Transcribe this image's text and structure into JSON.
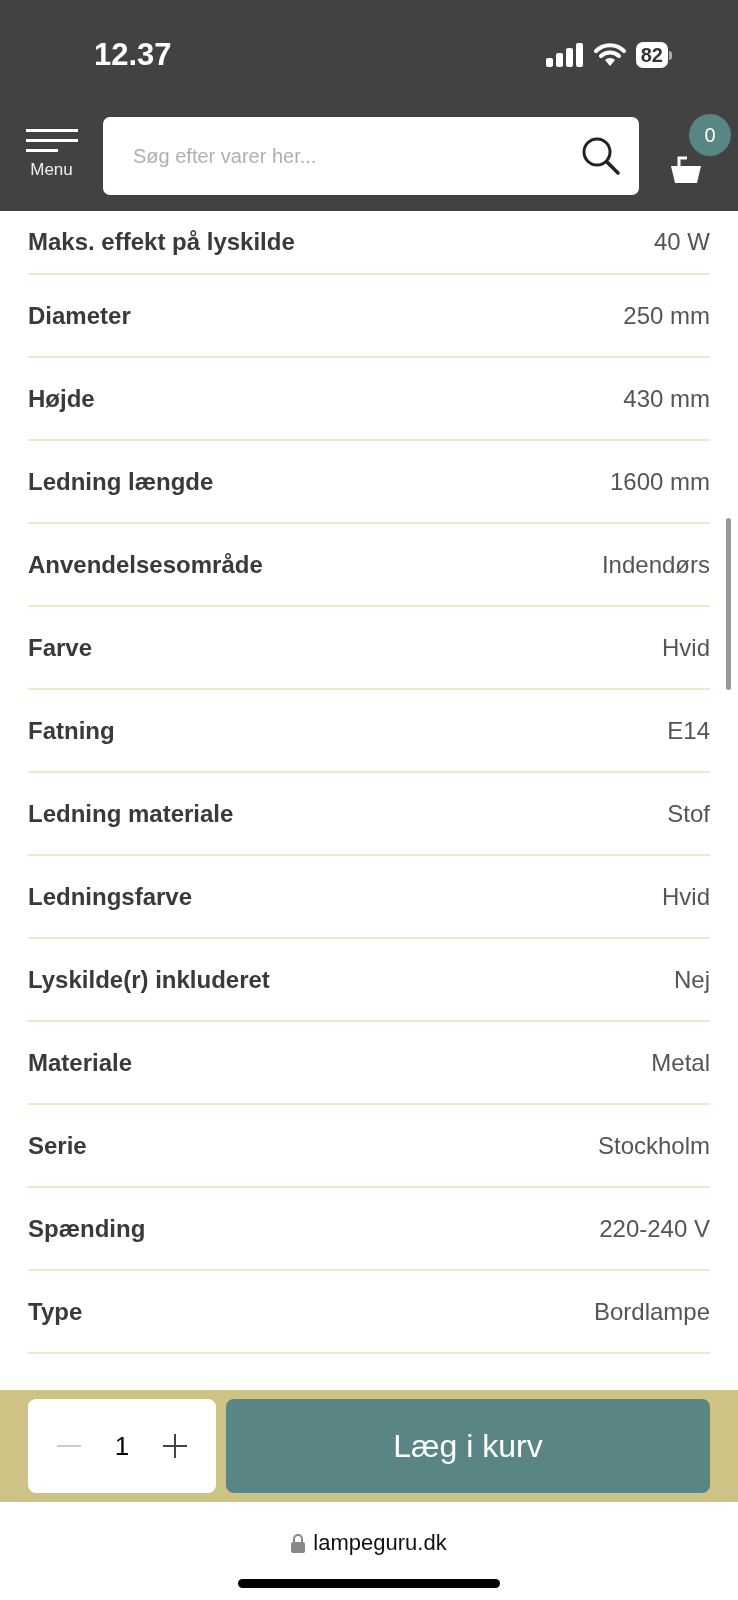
{
  "status_bar": {
    "time": "12.37",
    "battery": "82"
  },
  "header": {
    "menu_label": "Menu",
    "search": {
      "placeholder": "Søg efter varer her..."
    },
    "cart_count": "0"
  },
  "specs": [
    {
      "label": "Maks. effekt på lyskilde",
      "value": "40 W"
    },
    {
      "label": "Diameter",
      "value": "250 mm"
    },
    {
      "label": "Højde",
      "value": "430 mm"
    },
    {
      "label": "Ledning længde",
      "value": "1600 mm"
    },
    {
      "label": "Anvendelsesområde",
      "value": "Indendørs"
    },
    {
      "label": "Farve",
      "value": "Hvid"
    },
    {
      "label": "Fatning",
      "value": "E14"
    },
    {
      "label": "Ledning materiale",
      "value": "Stof"
    },
    {
      "label": "Ledningsfarve",
      "value": "Hvid"
    },
    {
      "label": "Lyskilde(r) inkluderet",
      "value": "Nej"
    },
    {
      "label": "Materiale",
      "value": "Metal"
    },
    {
      "label": "Serie",
      "value": "Stockholm"
    },
    {
      "label": "Spænding",
      "value": "220-240 V"
    },
    {
      "label": "Type",
      "value": "Bordlampe"
    }
  ],
  "cart_bar": {
    "quantity": "1",
    "button": "Læg i kurv"
  },
  "browser": {
    "url": "lampeguru.dk"
  }
}
